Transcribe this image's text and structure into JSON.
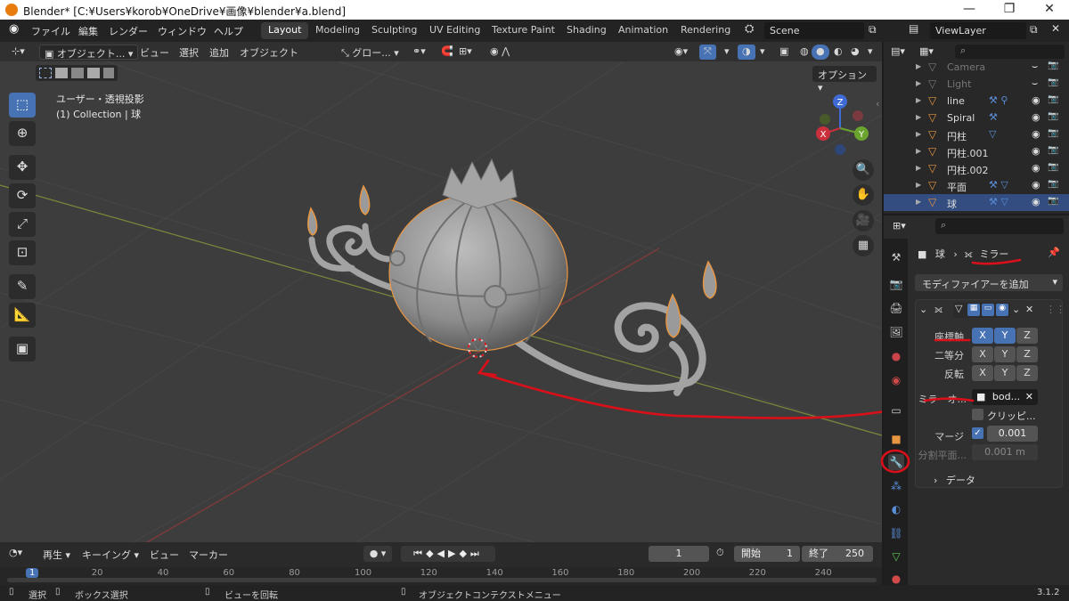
{
  "window": {
    "title": "Blender* [C:¥Users¥korob¥OneDrive¥画像¥blender¥a.blend]"
  },
  "menu": {
    "file": "ファイル",
    "edit": "編集",
    "render": "レンダー",
    "window": "ウィンドウ",
    "help": "ヘルプ"
  },
  "workspaces": [
    "Layout",
    "Modeling",
    "Sculpting",
    "UV Editing",
    "Texture Paint",
    "Shading",
    "Animation",
    "Rendering"
  ],
  "scene": "Scene",
  "view_layer": "ViewLayer",
  "viewport": {
    "mode": "オブジェクト...",
    "menus": {
      "view": "ビュー",
      "select": "選択",
      "add": "追加",
      "object": "オブジェクト"
    },
    "transform_orientation": "グロー...",
    "options": "オプション",
    "overlay_title": "ユーザー・透視投影",
    "overlay_collection": "(1) Collection | 球",
    "gizmo": {
      "z": "Z",
      "y": "Y",
      "x": "X"
    }
  },
  "outliner": {
    "items": [
      {
        "name": "Camera",
        "dim": true
      },
      {
        "name": "Light",
        "dim": true
      },
      {
        "name": "line",
        "dim": false
      },
      {
        "name": "Spiral",
        "dim": false
      },
      {
        "name": "円柱",
        "dim": false
      },
      {
        "name": "円柱.001",
        "dim": false
      },
      {
        "name": "円柱.002",
        "dim": false
      },
      {
        "name": "平面",
        "dim": false
      },
      {
        "name": "球",
        "dim": false,
        "selected": true
      }
    ]
  },
  "properties": {
    "breadcrumb_object": "球",
    "breadcrumb_modifier": "ミラー",
    "add_modifier": "モディファイアーを追加",
    "axis_label": "座標軸",
    "bisect_label": "二等分",
    "flip_label": "反転",
    "axes": [
      "X",
      "Y",
      "Z"
    ],
    "mirror_object_label": "ミラーオ...",
    "mirror_object_value": "bod...",
    "clipping_label": "クリッピ...",
    "merge_label": "マージ",
    "merge_value": "0.001",
    "bisect_distance_label": "分割平面...",
    "bisect_distance_value": "0.001 m",
    "data_label": "データ"
  },
  "timeline": {
    "playback": "再生",
    "keying": "キーイング",
    "view": "ビュー",
    "marker": "マーカー",
    "current_frame": "1",
    "start_label": "開始",
    "start_value": "1",
    "end_label": "終了",
    "end_value": "250",
    "ticks": [
      "1",
      "20",
      "40",
      "60",
      "80",
      "100",
      "120",
      "140",
      "160",
      "180",
      "200",
      "220",
      "240"
    ]
  },
  "statusbar": {
    "select": "選択",
    "box_select": "ボックス選択",
    "rotate_view": "ビューを回転",
    "context_menu": "オブジェクトコンテクストメニュー",
    "version": "3.1.2"
  },
  "colors": {
    "accent": "#4772b3",
    "annotation": "#d9101a",
    "object": "#e89642"
  }
}
